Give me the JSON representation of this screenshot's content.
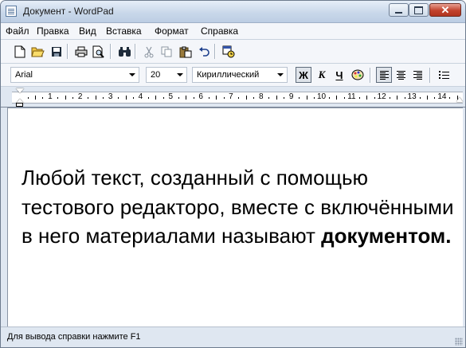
{
  "window": {
    "title": "Документ - WordPad",
    "close_label": "✕"
  },
  "menu": [
    "Файл",
    "Правка",
    "Вид",
    "Вставка",
    "Формат",
    "Справка"
  ],
  "toolbar": {
    "icons": [
      "new-document-icon",
      "open-folder-icon",
      "save-icon",
      "print-icon",
      "print-preview-icon",
      "find-icon",
      "cut-icon",
      "copy-icon",
      "paste-icon",
      "undo-icon",
      "insert-datetime-icon"
    ]
  },
  "format_bar": {
    "font": "Arial",
    "size": "20",
    "script": "Кириллический",
    "bold_label": "Ж",
    "italic_label": "К",
    "underline_label": "Ч"
  },
  "ruler": {
    "numbers": [
      "1",
      "2",
      "3",
      "4",
      "5",
      "6",
      "7",
      "8",
      "9",
      "10",
      "11",
      "12",
      "13",
      "14"
    ]
  },
  "document": {
    "text_normal": "Любой текст, созданный с помощью тестового редакторо, вместе с включёнными в него материалами называют ",
    "text_bold": "документом."
  },
  "status": {
    "text": "Для вывода справки нажмите F1"
  },
  "colors": {
    "title_gradient_top": "#e6eef8",
    "title_gradient_bottom": "#bccde3",
    "close_button": "#c2422d"
  }
}
